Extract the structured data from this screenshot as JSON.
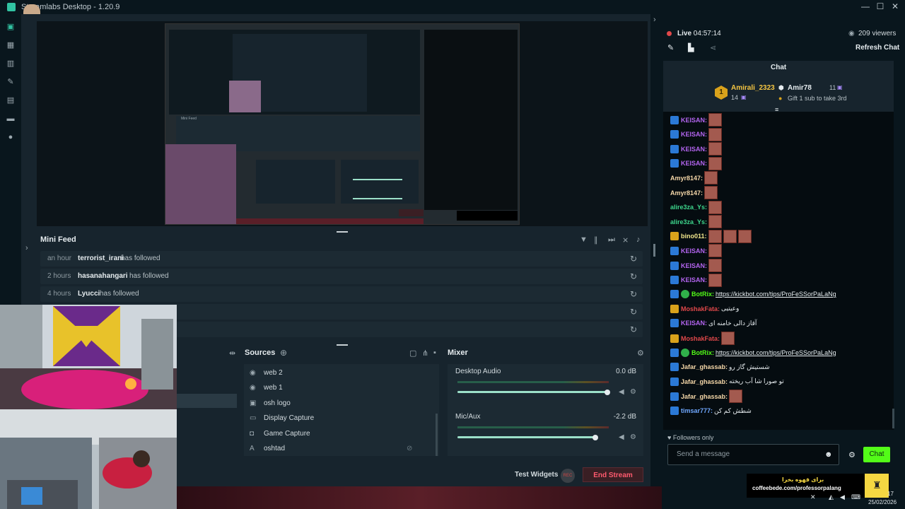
{
  "app": {
    "title": "Streamlabs Desktop - 1.20.9",
    "window_controls": [
      "—",
      "☐",
      "✕"
    ]
  },
  "mini_feed": {
    "title": "Mini Feed",
    "rows": [
      {
        "time": "an hour",
        "name": "terrorist_irani",
        "action": "has followed"
      },
      {
        "time": "2 hours",
        "name": "hasanahangari",
        "action": "has followed"
      },
      {
        "time": "4 hours",
        "name": "Lyucci",
        "action": "has followed"
      },
      {
        "time": "",
        "name": "",
        "action": ""
      },
      {
        "time": "",
        "name": "",
        "action": ""
      }
    ]
  },
  "sources": {
    "title": "Sources",
    "items": [
      {
        "label": "web 2",
        "icon": "webcam-icon"
      },
      {
        "label": "web 1",
        "icon": "webcam-icon"
      },
      {
        "label": "osh logo",
        "icon": "image-icon"
      },
      {
        "label": "Display Capture",
        "icon": "display-icon"
      },
      {
        "label": "Game Capture",
        "icon": "gamepad-icon"
      },
      {
        "label": "oshtad",
        "icon": "text-icon"
      }
    ]
  },
  "mixer": {
    "title": "Mixer",
    "channels": [
      {
        "name": "Desktop Audio",
        "db": "0.0 dB",
        "level": 0.99
      },
      {
        "name": "Mic/Aux",
        "db": "-2.2 dB",
        "level": 0.91
      }
    ]
  },
  "bottom": {
    "test_widgets": "Test Widgets",
    "rec": "REC",
    "end_stream": "End Stream"
  },
  "stream": {
    "live_label": "Live",
    "live_time": "04:57:14",
    "viewers": "209 viewers",
    "refresh_chat": "Refresh Chat"
  },
  "chat": {
    "title": "Chat",
    "leaderboard": {
      "first": {
        "rank": "1",
        "name": "Amirali_2323",
        "count": "14"
      },
      "second": {
        "name": "Amir78",
        "count": "11",
        "note": "Gift 1 sub to take 3rd"
      }
    },
    "messages": [
      {
        "user": "KEISAN:",
        "color": "#b465f0",
        "badge": "blue",
        "text": "",
        "emotes": 1
      },
      {
        "user": "KEISAN:",
        "color": "#b465f0",
        "badge": "blue",
        "text": "",
        "emotes": 1
      },
      {
        "user": "KEISAN:",
        "color": "#b465f0",
        "badge": "blue",
        "text": "",
        "emotes": 1
      },
      {
        "user": "KEISAN:",
        "color": "#b465f0",
        "badge": "blue",
        "text": "",
        "emotes": 1
      },
      {
        "user": "Amyr8147:",
        "color": "#f5d7a8",
        "badge": "",
        "text": "",
        "emotes": 1
      },
      {
        "user": "Amyr8147:",
        "color": "#f5d7a8",
        "badge": "",
        "text": "",
        "emotes": 1
      },
      {
        "user": "alire3za_Ys:",
        "color": "#3dd68c",
        "badge": "",
        "text": "",
        "emotes": 1
      },
      {
        "user": "alire3za_Ys:",
        "color": "#3dd68c",
        "badge": "",
        "text": "",
        "emotes": 1
      },
      {
        "user": "bino011:",
        "color": "#f0e68c",
        "badge": "gold",
        "text": "",
        "emotes": 3
      },
      {
        "user": "KEISAN:",
        "color": "#b465f0",
        "badge": "blue",
        "text": "",
        "emotes": 1
      },
      {
        "user": "KEISAN:",
        "color": "#b465f0",
        "badge": "blue",
        "text": "",
        "emotes": 1
      },
      {
        "user": "KEISAN:",
        "color": "#b465f0",
        "badge": "blue",
        "text": "",
        "emotes": 1
      },
      {
        "user": "BotRix:",
        "color": "#53fc18",
        "badge": "blue",
        "verified": true,
        "link": "https://kickbot.com/tips/ProFeSSorPaLaNg",
        "emotes": 0
      },
      {
        "user": "MoshakFata:",
        "color": "#e0484a",
        "badge": "gold",
        "text": "وعیتیی",
        "emotes": 0
      },
      {
        "user": "KEISAN:",
        "color": "#b465f0",
        "badge": "blue",
        "text": "آقاز دالی خامنه ای",
        "emotes": 0
      },
      {
        "user": "MoshakFata:",
        "color": "#e0484a",
        "badge": "gold",
        "text": "",
        "emotes": 1
      },
      {
        "user": "BotRix:",
        "color": "#53fc18",
        "badge": "blue",
        "verified": true,
        "link": "https://kickbot.com/tips/ProFeSSorPaLaNg",
        "emotes": 0
      },
      {
        "user": "Jafar_ghassab:",
        "color": "#f5d7a8",
        "badge": "blue",
        "text": "شستیش گاز رو",
        "emotes": 0
      },
      {
        "user": "Jafar_ghassab:",
        "color": "#f5d7a8",
        "badge": "blue",
        "text": "تو صورا شا آب ریخته",
        "emotes": 0
      },
      {
        "user": "Jafar_ghassab:",
        "color": "#f5d7a8",
        "badge": "blue",
        "text": "",
        "emotes": 1
      },
      {
        "user": "timsar777:",
        "color": "#6fa8ff",
        "badge": "blue",
        "text": "شطش کم کن",
        "emotes": 0
      }
    ],
    "followers_only": "Followers only",
    "input_placeholder": "Send a message",
    "send_label": "Chat"
  },
  "promo": {
    "line1": "برای قهوه بخرا",
    "line2": "coffeebede.com/professorpalang"
  },
  "clock": {
    "time": "17",
    "date": "25/02/2026"
  }
}
